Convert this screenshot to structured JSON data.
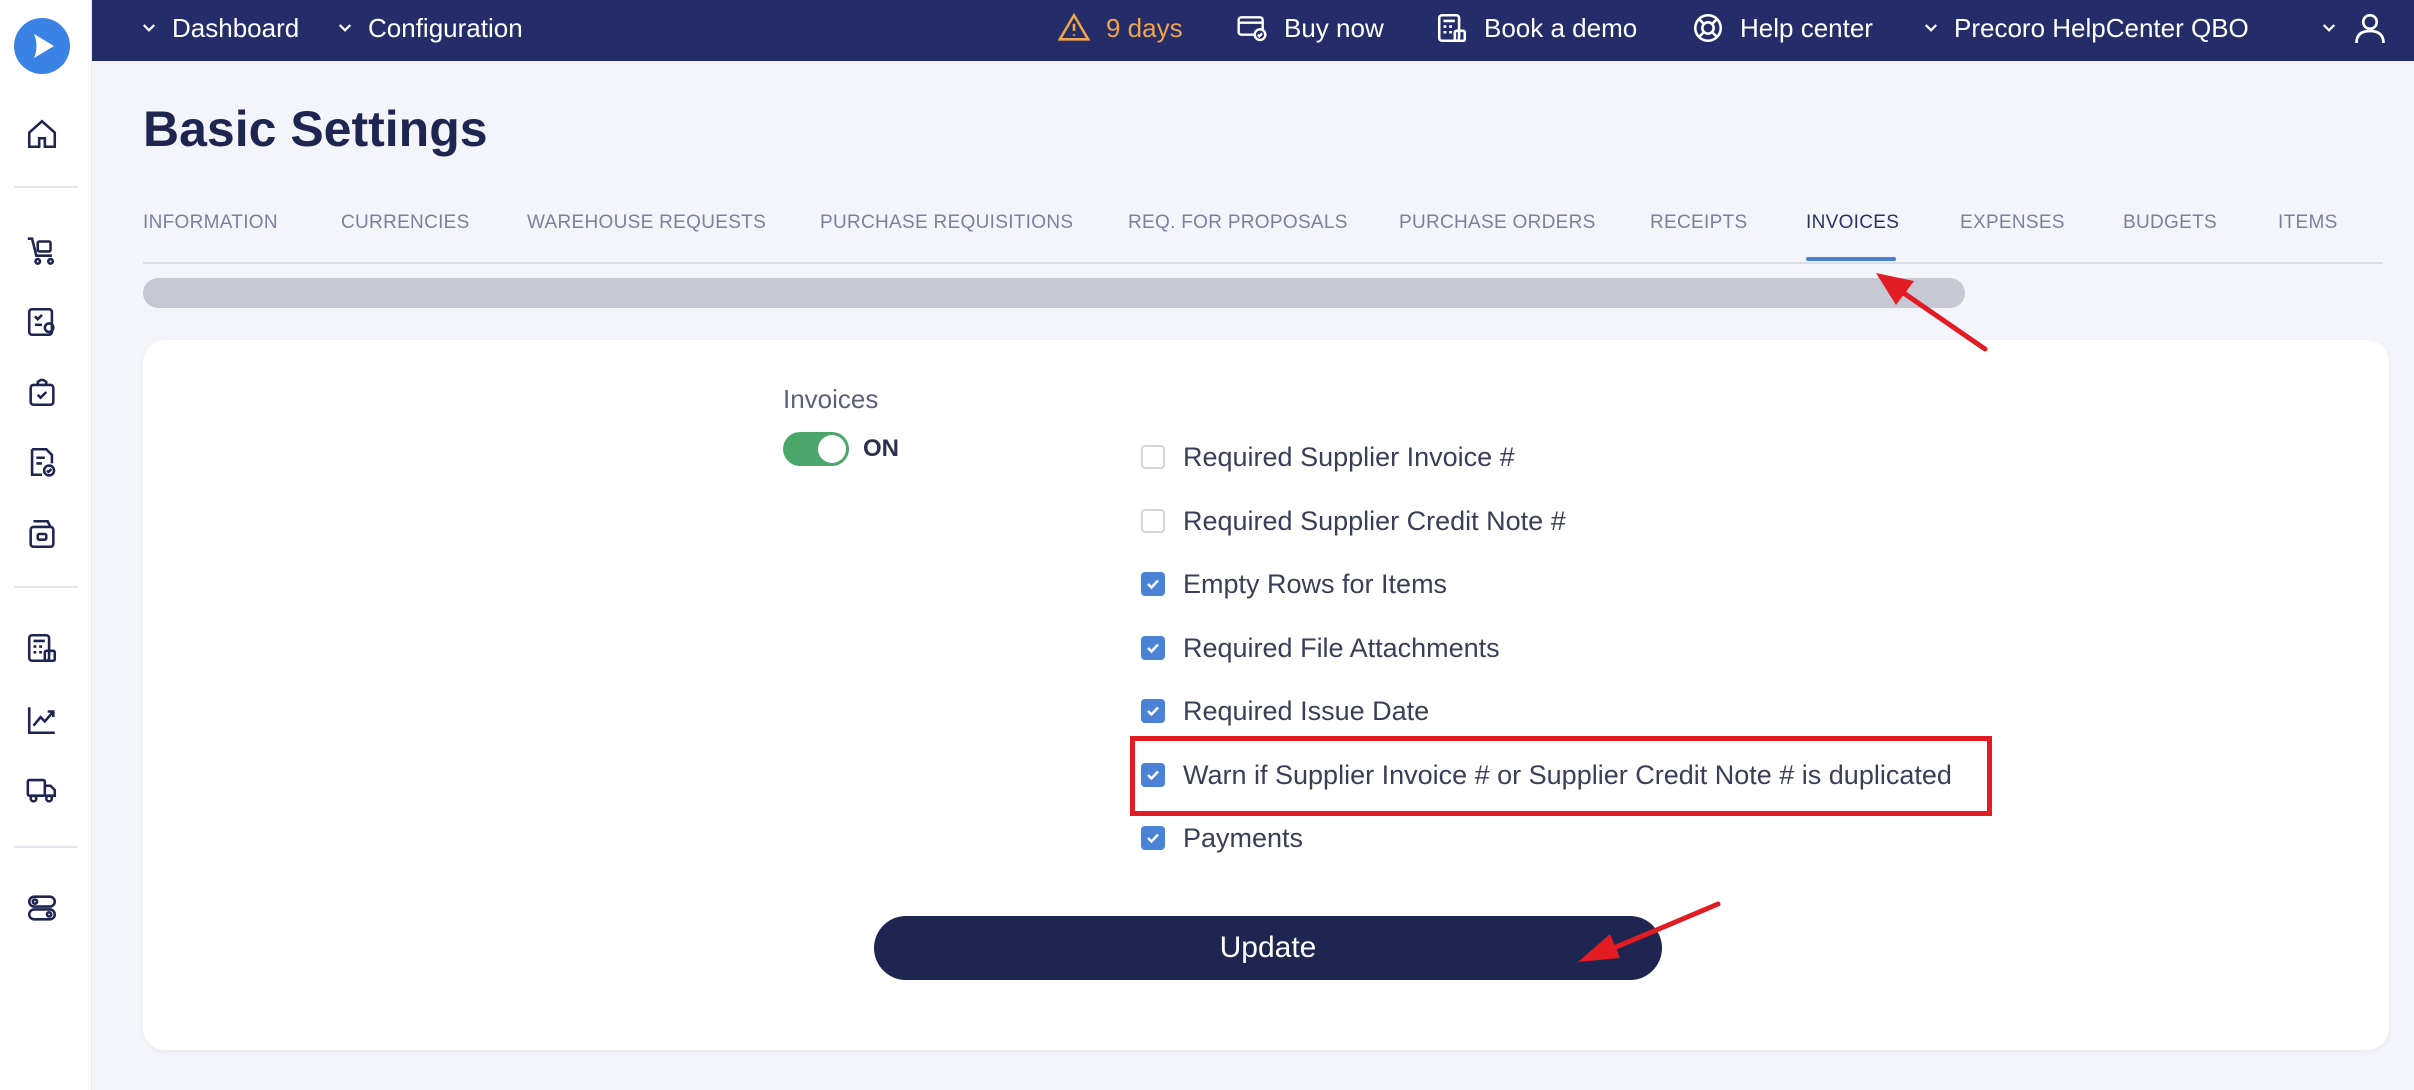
{
  "topbar": {
    "dashboard": "Dashboard",
    "configuration": "Configuration",
    "trial": "9 days",
    "buy_now": "Buy now",
    "book_demo": "Book a demo",
    "help_center": "Help center",
    "company": "Precoro HelpCenter QBO"
  },
  "page": {
    "title": "Basic Settings"
  },
  "tabs": [
    {
      "label": "INFORMATION"
    },
    {
      "label": "CURRENCIES"
    },
    {
      "label": "WAREHOUSE REQUESTS"
    },
    {
      "label": "PURCHASE REQUISITIONS"
    },
    {
      "label": "REQ. FOR PROPOSALS"
    },
    {
      "label": "PURCHASE ORDERS"
    },
    {
      "label": "RECEIPTS"
    },
    {
      "label": "INVOICES"
    },
    {
      "label": "EXPENSES"
    },
    {
      "label": "BUDGETS"
    },
    {
      "label": "ITEMS"
    }
  ],
  "active_tab": "INVOICES",
  "settings": {
    "section_label": "Invoices",
    "toggle_state": "ON",
    "options": [
      {
        "label": "Required Supplier Invoice #",
        "checked": false
      },
      {
        "label": "Required Supplier Credit Note #",
        "checked": false
      },
      {
        "label": "Empty Rows for Items",
        "checked": true
      },
      {
        "label": "Required File Attachments",
        "checked": true
      },
      {
        "label": "Required Issue Date",
        "checked": true
      },
      {
        "label": "Warn if Supplier Invoice # or Supplier Credit Note # is duplicated",
        "checked": true
      },
      {
        "label": "Payments",
        "checked": true
      }
    ],
    "update_label": "Update"
  },
  "colors": {
    "topbar": "#242d69",
    "accent": "#4a82d6",
    "toggle_on": "#4aa66b",
    "highlight": "#e31b23",
    "warning": "#f0a44c"
  }
}
